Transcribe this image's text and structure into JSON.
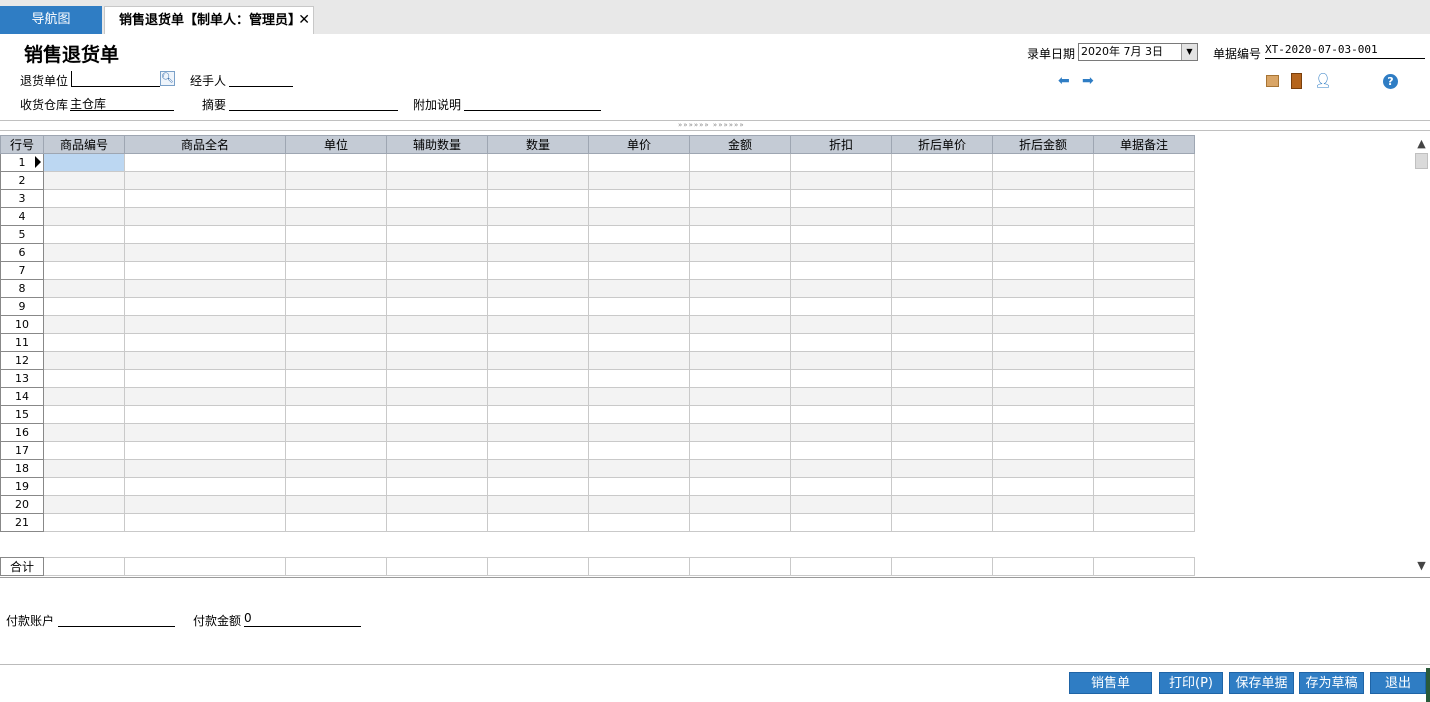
{
  "tabs": {
    "nav": "导航图",
    "active": "销售退货单【制单人：管理员】",
    "close": "✕"
  },
  "header": {
    "title": "销售退货单",
    "return_unit_label": "退货单位",
    "return_unit_value": "",
    "handler_label": "经手人",
    "handler_value": "",
    "warehouse_label": "收货仓库",
    "warehouse_value": "主仓库",
    "summary_label": "摘要",
    "summary_value": "",
    "note_label": "附加说明",
    "note_value": "",
    "date_label": "录单日期",
    "date_value": "2020年 7月 3日",
    "doc_no_label": "单据编号",
    "doc_no_value": "XT-2020-07-03-001"
  },
  "icons": [
    "arrow-left-icon",
    "arrow-right-icon",
    "box-icon",
    "door-icon",
    "user-icon",
    "help-icon"
  ],
  "splitter_grip": "»»»»»»  »»»»»»",
  "grid": {
    "row_header": "行号",
    "columns": [
      "商品编号",
      "商品全名",
      "单位",
      "辅助数量",
      "数量",
      "单价",
      "金额",
      "折扣",
      "折后单价",
      "折后金额",
      "单据备注"
    ],
    "rows": [
      "1",
      "2",
      "3",
      "4",
      "5",
      "6",
      "7",
      "8",
      "9",
      "10",
      "11",
      "12",
      "13",
      "14",
      "15",
      "16",
      "17",
      "18",
      "19",
      "20",
      "21"
    ],
    "total_label": "合计"
  },
  "payment": {
    "account_label": "付款账户",
    "account_value": "",
    "amount_label": "付款金额",
    "amount_value": "0"
  },
  "buttons": {
    "sales_order": "销售单",
    "print": "打印(P)",
    "save": "保存单据",
    "draft": "存为草稿",
    "exit": "退出"
  },
  "colors": {
    "accent": "#2f7dc4",
    "grid_header": "#c4cbd5",
    "selected_cell": "#bcd7f2"
  }
}
